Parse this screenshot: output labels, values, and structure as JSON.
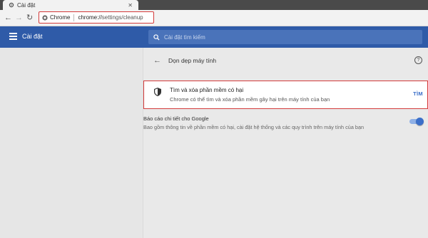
{
  "tab": {
    "title": "Cài đặt"
  },
  "address_bar": {
    "chrome_label": "Chrome",
    "url_host": "chrome://",
    "url_path": "settings/cleanup"
  },
  "header": {
    "title": "Cài đặt",
    "search_placeholder": "Cài đặt tìm kiếm"
  },
  "page": {
    "title": "Dọn dẹp máy tính"
  },
  "cleanup_card": {
    "title": "Tìm và xóa phần mềm có hại",
    "description": "Chrome có thể tìm và xóa phần mềm gây hại trên máy tính của bạn",
    "button": "TÌM"
  },
  "report": {
    "title": "Báo cáo chi tiết cho Google",
    "description": "Bao gồm thông tin về phần mềm có hại, cài đặt hệ thống và các quy trình trên máy tính của bạn",
    "toggle_on": true
  },
  "colors": {
    "header_bg": "#2f5ba8",
    "accent": "#3b6fc9",
    "highlight_border": "#d33a3a"
  },
  "icons": [
    "settings-gear-icon",
    "close-icon",
    "back-icon",
    "forward-icon",
    "reload-icon",
    "menu-icon",
    "search-icon",
    "help-icon",
    "shield-icon"
  ]
}
